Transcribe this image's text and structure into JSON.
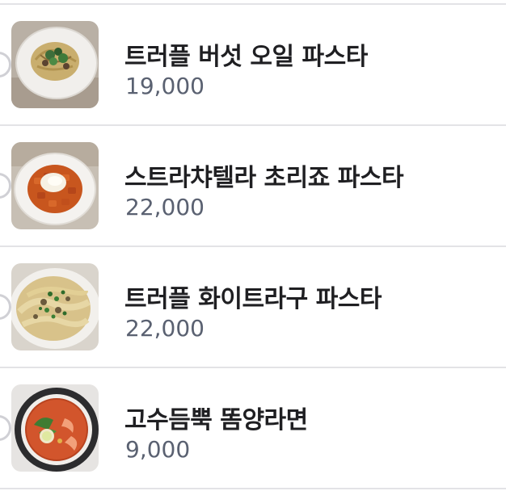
{
  "menu": {
    "items": [
      {
        "name": "트러플 버섯 오일 파스타",
        "price": "19,000",
        "image_icon": "truffle-mushroom-pasta-photo"
      },
      {
        "name": "스트라챠텔라 초리죠 파스타",
        "price": "22,000",
        "image_icon": "stracciatella-chorizo-pasta-photo"
      },
      {
        "name": "트러플 화이트라구 파스타",
        "price": "22,000",
        "image_icon": "truffle-white-ragu-pasta-photo"
      },
      {
        "name": "고수듬뿍 똠양라면",
        "price": "9,000",
        "image_icon": "tom-yum-ramen-photo"
      }
    ]
  }
}
